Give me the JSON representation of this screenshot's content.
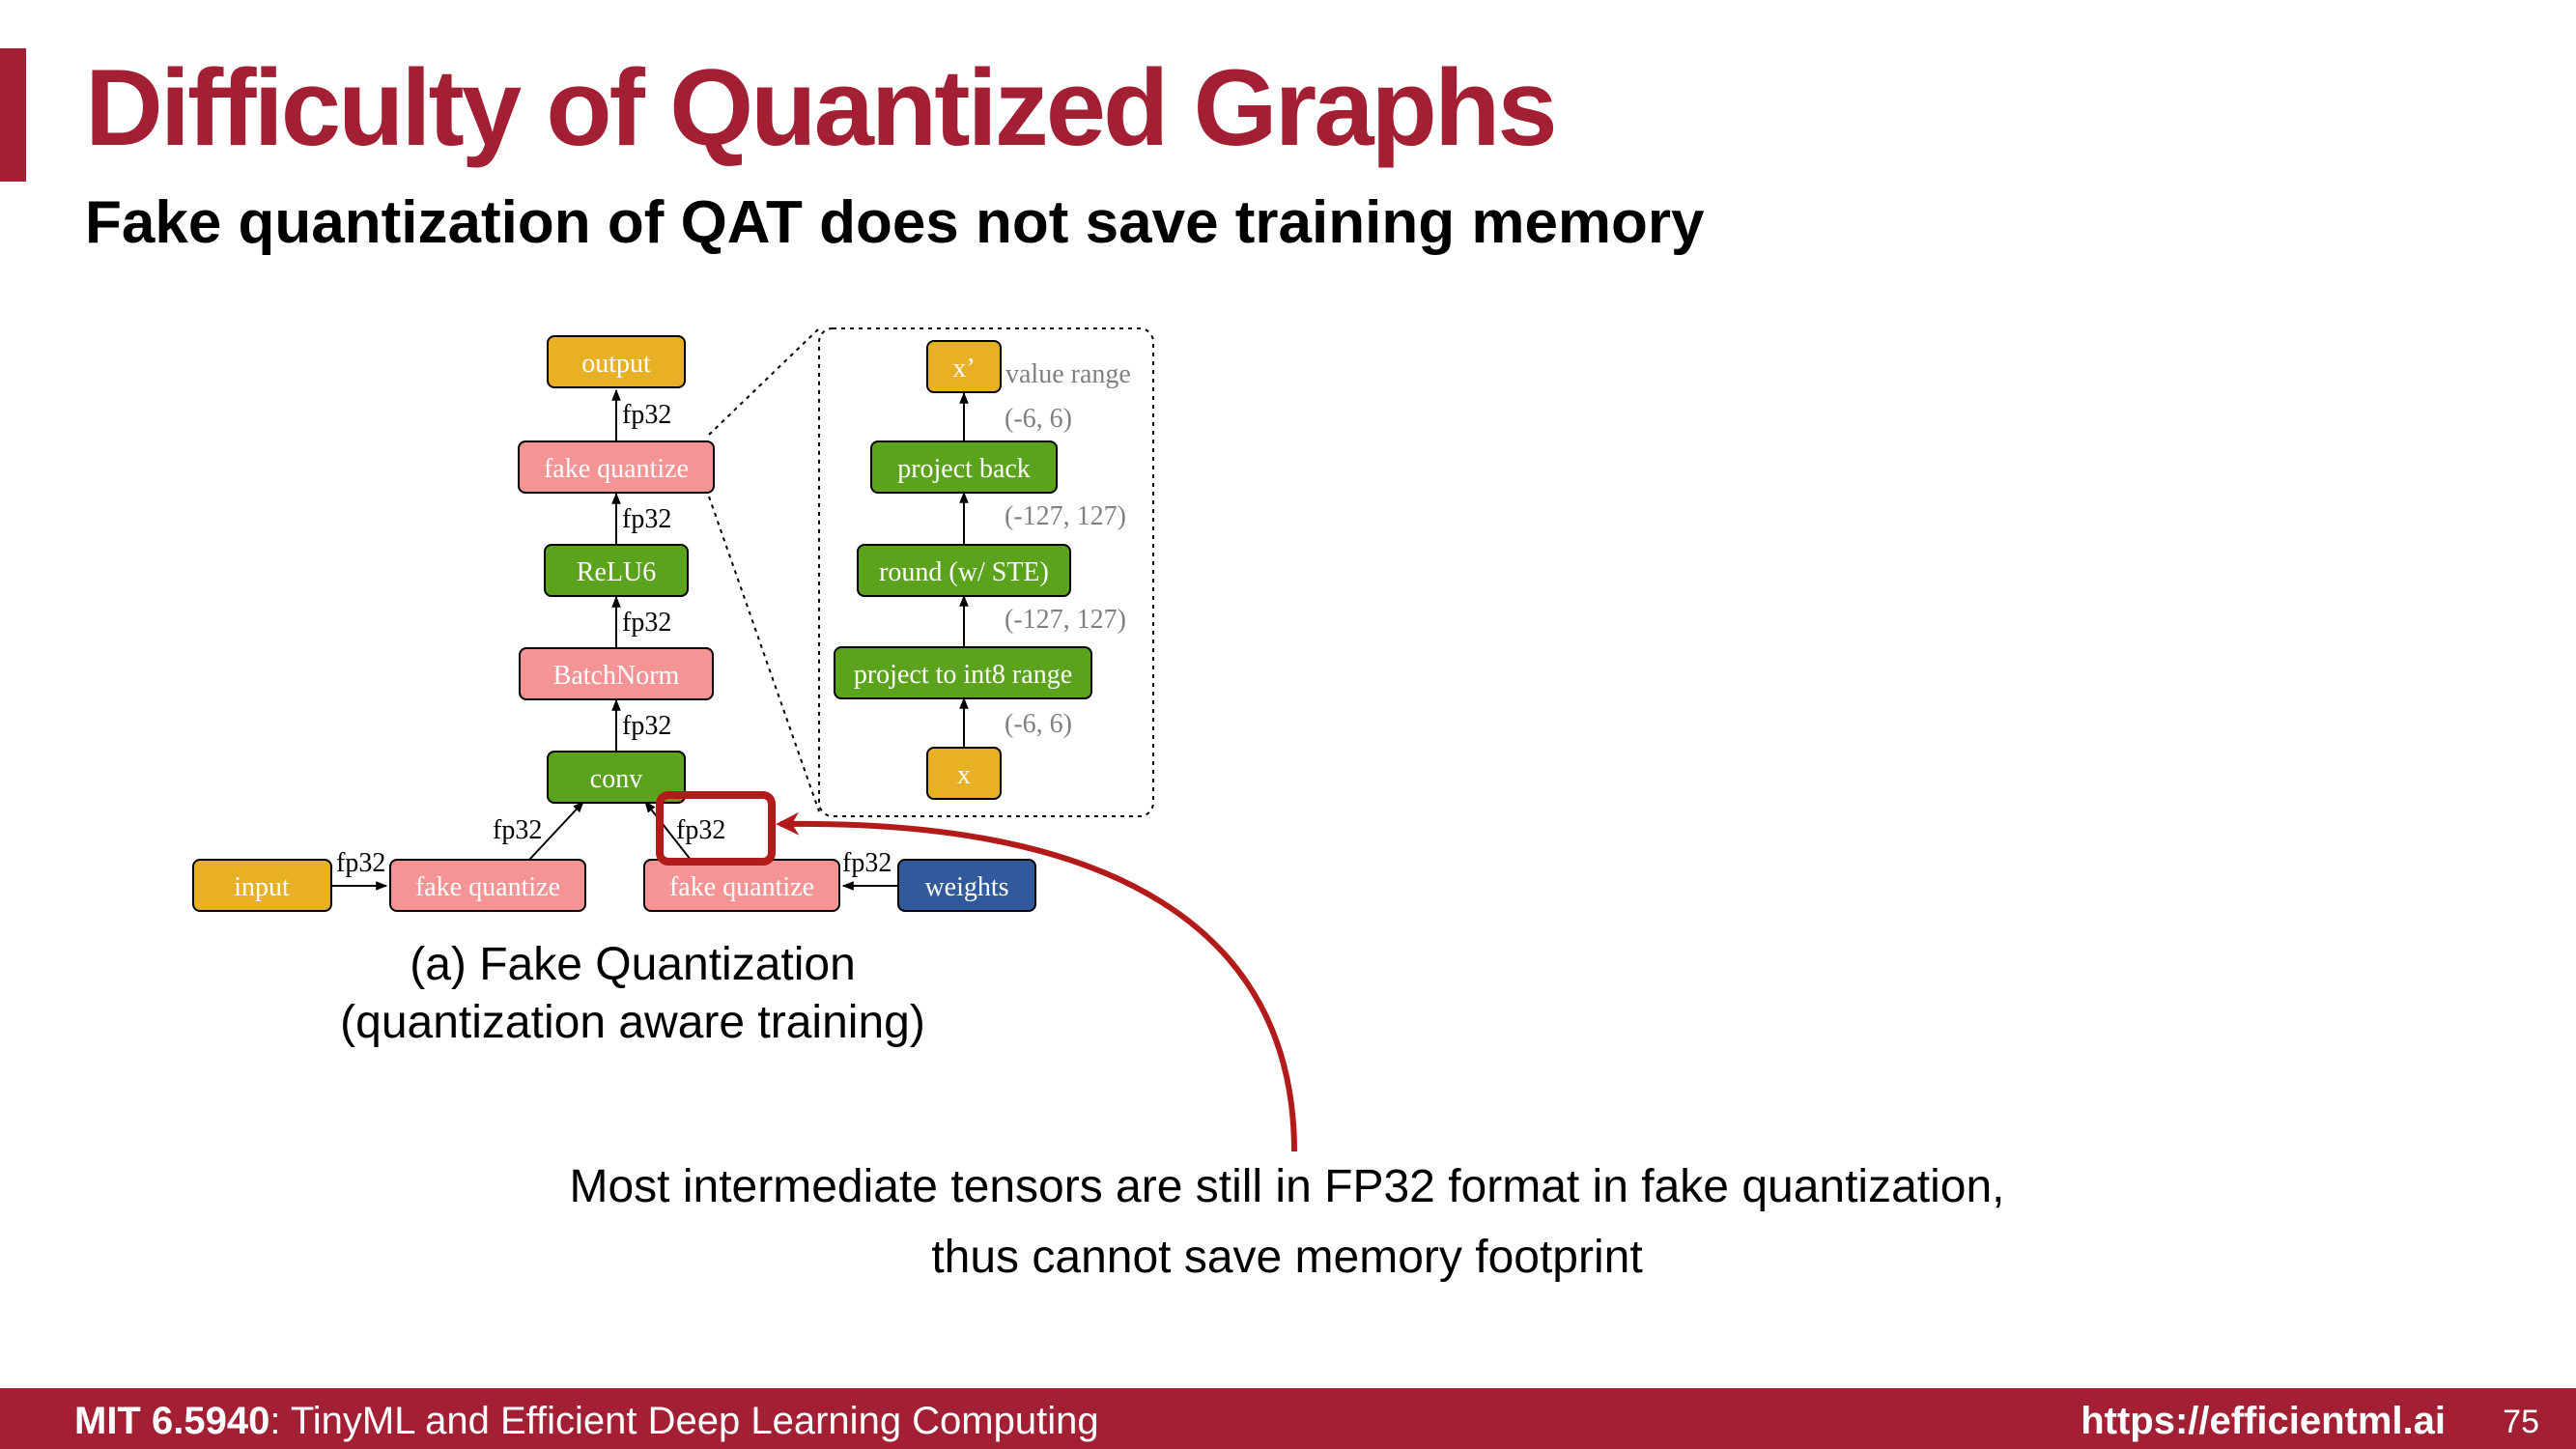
{
  "slide": {
    "title": "Difficulty of Quantized Graphs",
    "subtitle": "Fake quantization of QAT does not save training memory"
  },
  "diagram": {
    "nodes": {
      "output": "output",
      "fake_quantize_top": "fake quantize",
      "relu6": "ReLU6",
      "batchnorm": "BatchNorm",
      "conv": "conv",
      "input": "input",
      "fake_quantize_input": "fake quantize",
      "fake_quantize_weights": "fake quantize",
      "weights": "weights"
    },
    "edge_label": "fp32",
    "detail": {
      "x_prime": "x’",
      "value_range_label": "value range",
      "project_back": "project back",
      "round": "round (w/ STE)",
      "project_int8": "project to int8 range",
      "x": "x",
      "range_6": "(-6, 6)",
      "range_127": "(-127, 127)"
    },
    "caption_line1": "(a) Fake Quantization",
    "caption_line2": "(quantization aware training)"
  },
  "note": {
    "line1": "Most intermediate tensors are still in FP32 format in fake quantization,",
    "line2": "thus cannot save memory footprint"
  },
  "footer": {
    "course_code": "MIT 6.5940",
    "course_rest": ": TinyML and Efficient Deep Learning Computing",
    "url": "https://efficientml.ai",
    "page": "75"
  },
  "colors": {
    "brand": "#a31f34",
    "yellow": "#e8b024",
    "pink": "#f49494",
    "green": "#5ba31c",
    "blue": "#315a9c",
    "highlight": "#b31b1b"
  }
}
